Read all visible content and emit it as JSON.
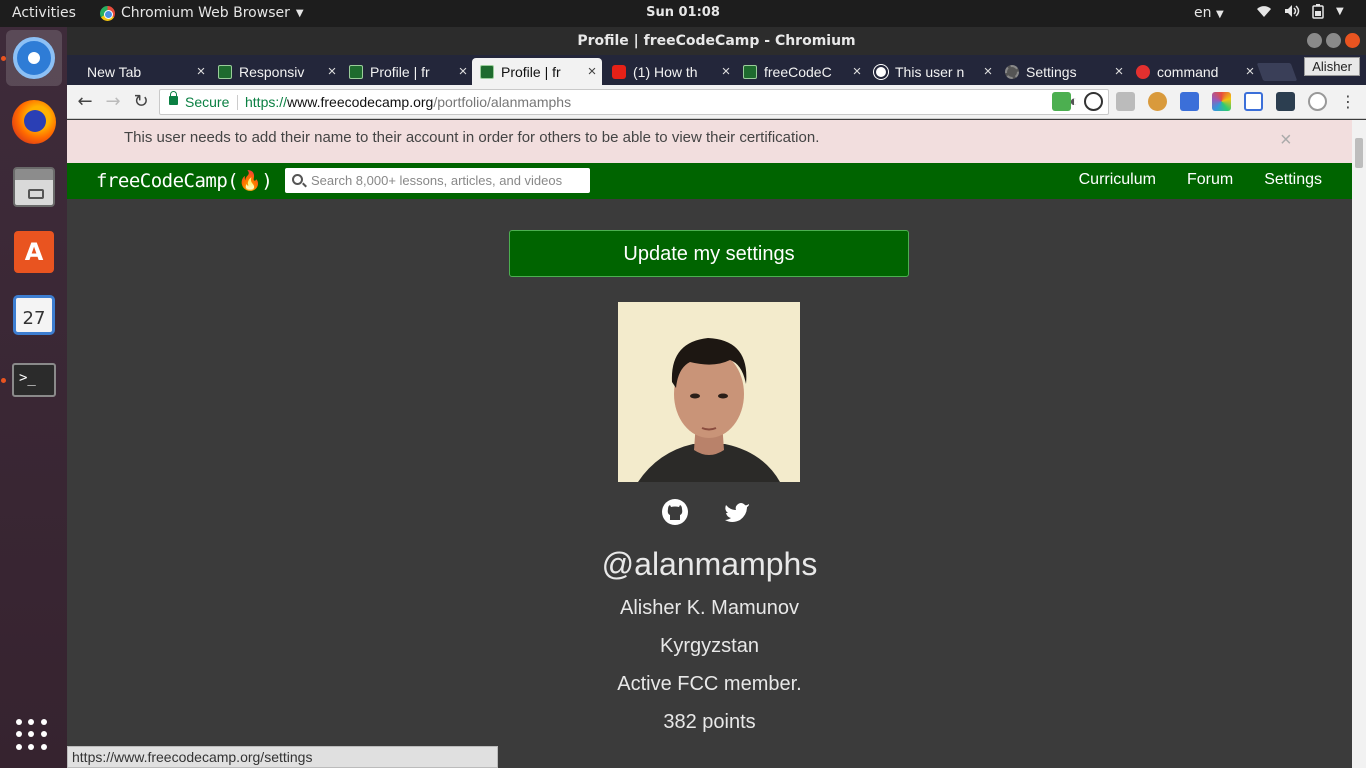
{
  "system": {
    "activities": "Activities",
    "app_menu": "Chromium Web Browser",
    "clock": "Sun 01:08",
    "language": "en"
  },
  "dock": {
    "calendar_day": "27",
    "terminal_prompt": ">_"
  },
  "window": {
    "title": "Profile | freeCodeCamp - Chromium",
    "profile_name": "Alisher"
  },
  "tabs": [
    {
      "label": "New Tab",
      "icon": "none"
    },
    {
      "label": "Responsiv",
      "icon": "fcc-icon"
    },
    {
      "label": "Profile | fr",
      "icon": "fcc-icon"
    },
    {
      "label": "Profile | fr",
      "icon": "fcc-icon",
      "active": true
    },
    {
      "label": "(1) How th",
      "icon": "youtube-icon"
    },
    {
      "label": "freeCodeC",
      "icon": "fcc-icon"
    },
    {
      "label": "This user n",
      "icon": "github-icon"
    },
    {
      "label": "Settings",
      "icon": "gear-icon"
    },
    {
      "label": "command",
      "icon": "askubuntu-icon"
    }
  ],
  "omnibox": {
    "secure_label": "Secure",
    "url_scheme": "https://",
    "url_host": "www.freecodecamp.org",
    "url_path": "/portfolio/alanmamphs"
  },
  "alert": {
    "message": "This user needs to add their name to their account in order for others to be able to view their certification.",
    "close": "×"
  },
  "fcc_nav": {
    "logo": "freeCodeCamp(🔥)",
    "search_placeholder": "Search 8,000+ lessons, articles, and videos",
    "links": [
      "Curriculum",
      "Forum",
      "Settings"
    ]
  },
  "profile": {
    "update_button": "Update my settings",
    "username": "@alanmamphs",
    "name": "Alisher K. Mamunov",
    "location": "Kyrgyzstan",
    "bio": "Active FCC member.",
    "points": "382 points"
  },
  "status_bar": "https://www.freecodecamp.org/settings",
  "colors": {
    "fcc_green": "#006400",
    "alert_bg": "#f2dede",
    "page_bg": "#3b3b3b",
    "ubuntu_orange": "#e95420"
  }
}
